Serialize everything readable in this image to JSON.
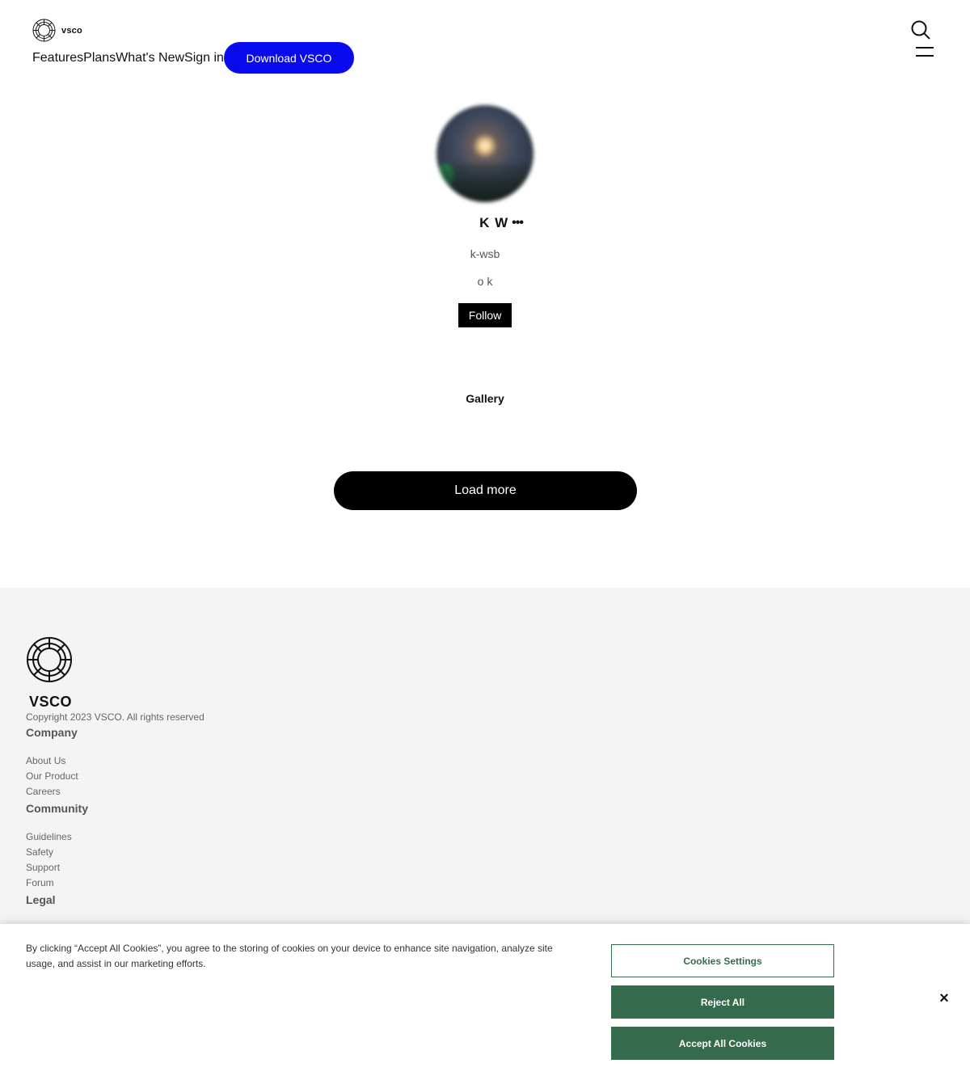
{
  "header": {
    "logo_text": "vsco",
    "nav": [
      "Features",
      "Plans",
      "What's New",
      "Sign in"
    ],
    "download_label": "Download VSCO",
    "icons": {
      "logo": "vsco-logo-icon",
      "search": "search-icon",
      "menu": "hamburger-menu-icon"
    }
  },
  "profile": {
    "name": "K W",
    "more_label": "•••",
    "username": "k-wsb",
    "bio": "o k",
    "follow_label": "Follow"
  },
  "gallery": {
    "tab_label": "Gallery",
    "load_more_label": "Load more"
  },
  "footer": {
    "wordmark": "VSCO",
    "copyright": "Copyright 2023 VSCO. All rights reserved",
    "company_heading": "Company",
    "company_links": [
      "About Us",
      "Our Product",
      "Careers"
    ],
    "community_heading": "Community",
    "community_links": [
      "Guidelines",
      "Safety",
      "Support",
      "Forum"
    ],
    "legal_heading": "Legal"
  },
  "cookie_banner": {
    "text": "By clicking “Accept All Cookies”, you agree to the storing of cookies on your device to enhance site navigation, analyze site usage, and assist in our marketing efforts.",
    "settings_label": "Cookies Settings",
    "reject_label": "Reject All",
    "accept_label": "Accept All Cookies",
    "close_label": "×",
    "accent_color": "#356b4c"
  },
  "colors": {
    "download_button": "#0a0aee",
    "footer_bg": "#f4f4f4"
  }
}
